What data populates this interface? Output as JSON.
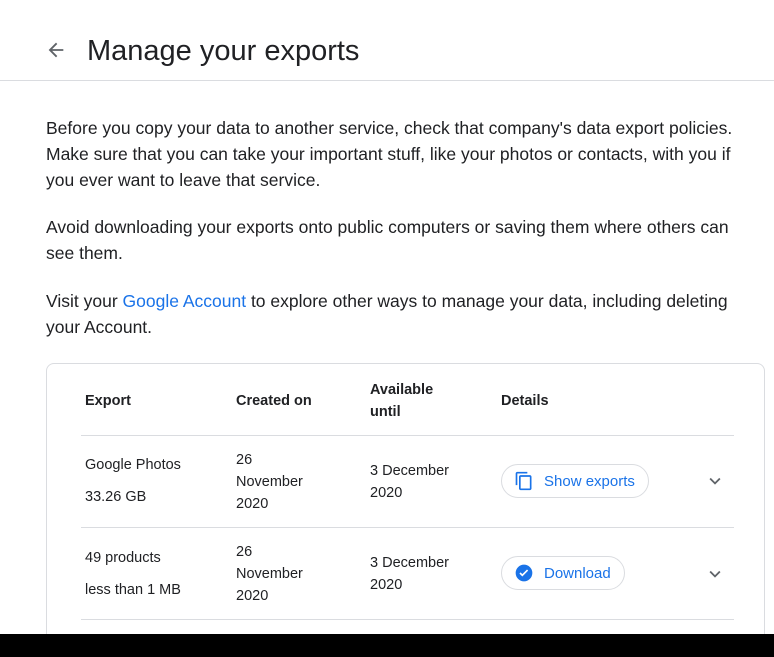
{
  "header": {
    "title": "Manage your exports",
    "back_icon": "arrow-back-icon"
  },
  "intro": {
    "p1": "Before you copy your data to another service, check that company's data export policies. Make sure that you can take your important stuff, like your photos or contacts, with you if you ever want to leave that service.",
    "p2": "Avoid downloading your exports onto public computers or saving them where others can see them.",
    "p3_before": "Visit your ",
    "p3_link": "Google Account",
    "p3_after": " to explore other ways to manage your data, including deleting your Account."
  },
  "table": {
    "headers": {
      "export": "Export",
      "created": "Created on",
      "available_line1": "Available",
      "available_line2": "until",
      "details": "Details"
    },
    "rows": [
      {
        "name": "Google Photos",
        "size": "33.26 GB",
        "created": [
          "26",
          "November",
          "2020"
        ],
        "available": [
          "3 December",
          "2020"
        ],
        "action_label": "Show exports",
        "action_icon": "copy-icon",
        "expand_icon": "chevron-down-icon"
      },
      {
        "name": "49 products",
        "size": "less than 1 MB",
        "created": [
          "26",
          "November",
          "2020"
        ],
        "available": [
          "3 December",
          "2020"
        ],
        "action_label": "Download",
        "action_icon": "check-circle-icon",
        "expand_icon": "chevron-down-icon"
      }
    ]
  },
  "colors": {
    "accent": "#1a73e8",
    "text": "#202124",
    "border": "#dadce0"
  }
}
